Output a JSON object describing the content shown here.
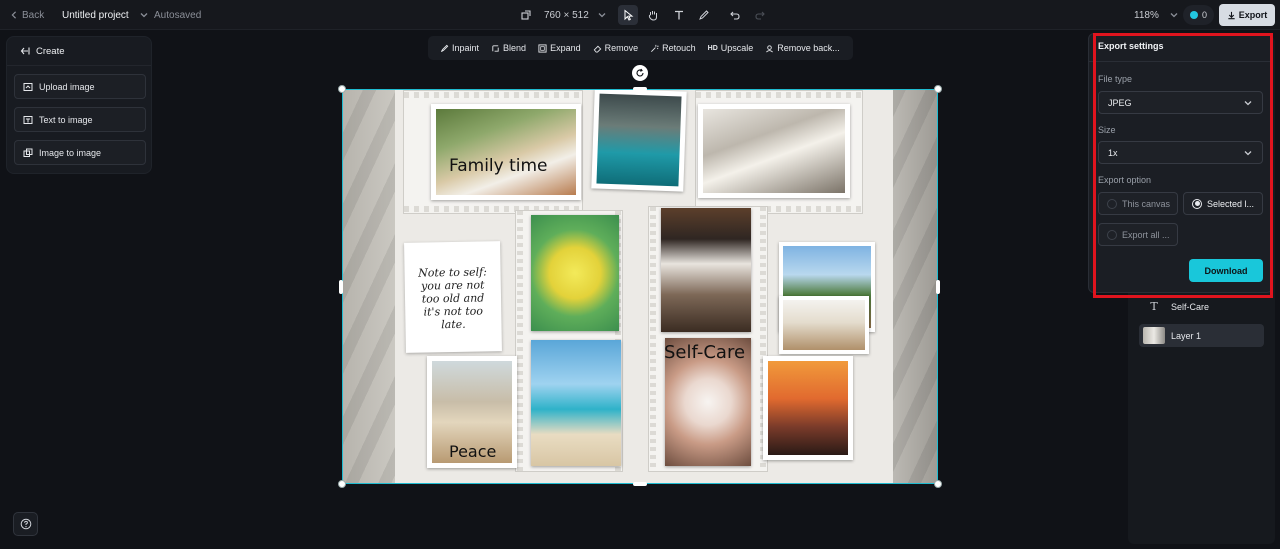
{
  "topbar": {
    "back_label": "Back",
    "project_title": "Untitled project",
    "save_status": "Autosaved",
    "canvas_size": "760 × 512",
    "zoom": "118%",
    "credits": "0",
    "export_label": "Export"
  },
  "create_panel": {
    "title": "Create",
    "items": [
      {
        "label": "Upload image",
        "icon": "upload-image-icon"
      },
      {
        "label": "Text to image",
        "icon": "text-to-image-icon"
      },
      {
        "label": "Image to image",
        "icon": "image-to-image-icon"
      }
    ]
  },
  "tools": [
    {
      "label": "Inpaint",
      "icon": "brush-icon"
    },
    {
      "label": "Blend",
      "icon": "blend-icon"
    },
    {
      "label": "Expand",
      "icon": "expand-icon"
    },
    {
      "label": "Remove",
      "icon": "eraser-icon"
    },
    {
      "label": "Retouch",
      "icon": "retouch-icon"
    },
    {
      "label": "Upscale",
      "icon": "hd-icon",
      "prefix": "HD"
    },
    {
      "label": "Remove back...",
      "icon": "remove-background-icon"
    }
  ],
  "canvas": {
    "texts": {
      "family": "Family time",
      "selfcare": "Self-Care",
      "peace": "Peace",
      "note_lines": [
        "Note to self:",
        "you are not",
        "too old and",
        "it's not too",
        "late."
      ]
    }
  },
  "layers": [
    {
      "label": "Self-Care",
      "type": "text"
    },
    {
      "label": "Layer 1",
      "type": "image"
    }
  ],
  "export_settings": {
    "title": "Export settings",
    "file_type_label": "File type",
    "file_type_value": "JPEG",
    "size_label": "Size",
    "size_value": "1x",
    "option_label": "Export option",
    "options": [
      {
        "label": "This canvas",
        "selected": false
      },
      {
        "label": "Selected l...",
        "selected": true
      },
      {
        "label": "Export all ...",
        "selected": false
      }
    ],
    "download_label": "Download"
  },
  "colors": {
    "accent": "#19c7da",
    "selection": "#1fbcd1",
    "highlight_box": "#e0141e"
  }
}
